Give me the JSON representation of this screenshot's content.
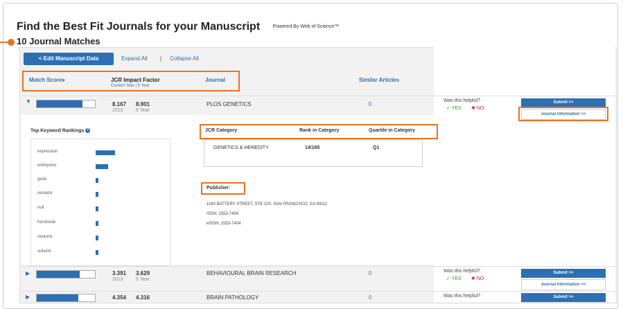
{
  "header": {
    "title": "Find the Best Fit Journals for your Manuscript",
    "powered_by": "Powered By Web of Science™",
    "matches": "10 Journal Matches"
  },
  "toolbar": {
    "edit_button": "< Edit Manuscript Data",
    "expand_all": "Expand All",
    "separator": "|",
    "collapse_all": "Collapse All"
  },
  "columns": {
    "match_score": "Match Score♦",
    "jcr_impact": "JCR Impact Factor",
    "jcr_impact_sub": "Current Year | 5 Year",
    "journal": "Journal",
    "similar_articles": "Similar Articles"
  },
  "rows": [
    {
      "match_fraction": 0.78,
      "if_current": "8.167",
      "year": "2013",
      "if_5yr": "8.901",
      "five_year_label": "5 Year",
      "journal": "PLOS GENETICS",
      "similar": "0",
      "helpful": "Was this helpful?",
      "yes": "YES",
      "no": "NO",
      "submit": "Submit >>",
      "journal_info": "Journal Information >>"
    },
    {
      "match_fraction": 0.74,
      "if_current": "3.391",
      "year": "2013",
      "if_5yr": "3.629",
      "five_year_label": "5 Year",
      "journal": "BEHAVIOURAL BRAIN RESEARCH",
      "similar": "0",
      "helpful": "Was this helpful?",
      "yes": "YES",
      "no": "NO",
      "submit": "Submit >>",
      "journal_info": "Journal Information >>"
    },
    {
      "match_fraction": 0.72,
      "if_current": "4.354",
      "year": "",
      "if_5yr": "4.316",
      "five_year_label": "",
      "journal": "BRAIN PATHOLOGY",
      "similar": "0",
      "helpful": "Was this helpful?",
      "yes": "",
      "no": "",
      "submit": "Submit >>",
      "journal_info": ""
    }
  ],
  "details": {
    "keyword_title": "Top Keyword Rankings",
    "keywords": [
      {
        "label": "expression",
        "fraction": 1.0
      },
      {
        "label": "embryonic",
        "fraction": 0.65
      },
      {
        "label": "gene",
        "fraction": 0.15
      },
      {
        "label": "receptor",
        "fraction": 0.15
      },
      {
        "label": "null",
        "fraction": 0.15
      },
      {
        "label": "functional",
        "fraction": 0.15
      },
      {
        "label": "neurons",
        "fraction": 0.15
      },
      {
        "label": "subunit",
        "fraction": 0.15
      }
    ],
    "jcr_category_header": "JCR Category",
    "rank_header": "Rank in Category",
    "quartile_header": "Quartile in Category",
    "category": "GENETICS & HEREDITY",
    "rank": "14/165",
    "quartile": "Q1",
    "publisher_header": "Publisher:",
    "publisher_address": "1160 BATTERY STREET, STE 100, SAN FRANCISCO, CA 94111",
    "issn": "ISSN: 1553-7404",
    "eissn": "eISSN: 1553-7404"
  },
  "colors": {
    "accent": "#2c6fb3",
    "highlight": "#e8731f",
    "yes": "#2a9a2a",
    "no": "#d32020"
  }
}
